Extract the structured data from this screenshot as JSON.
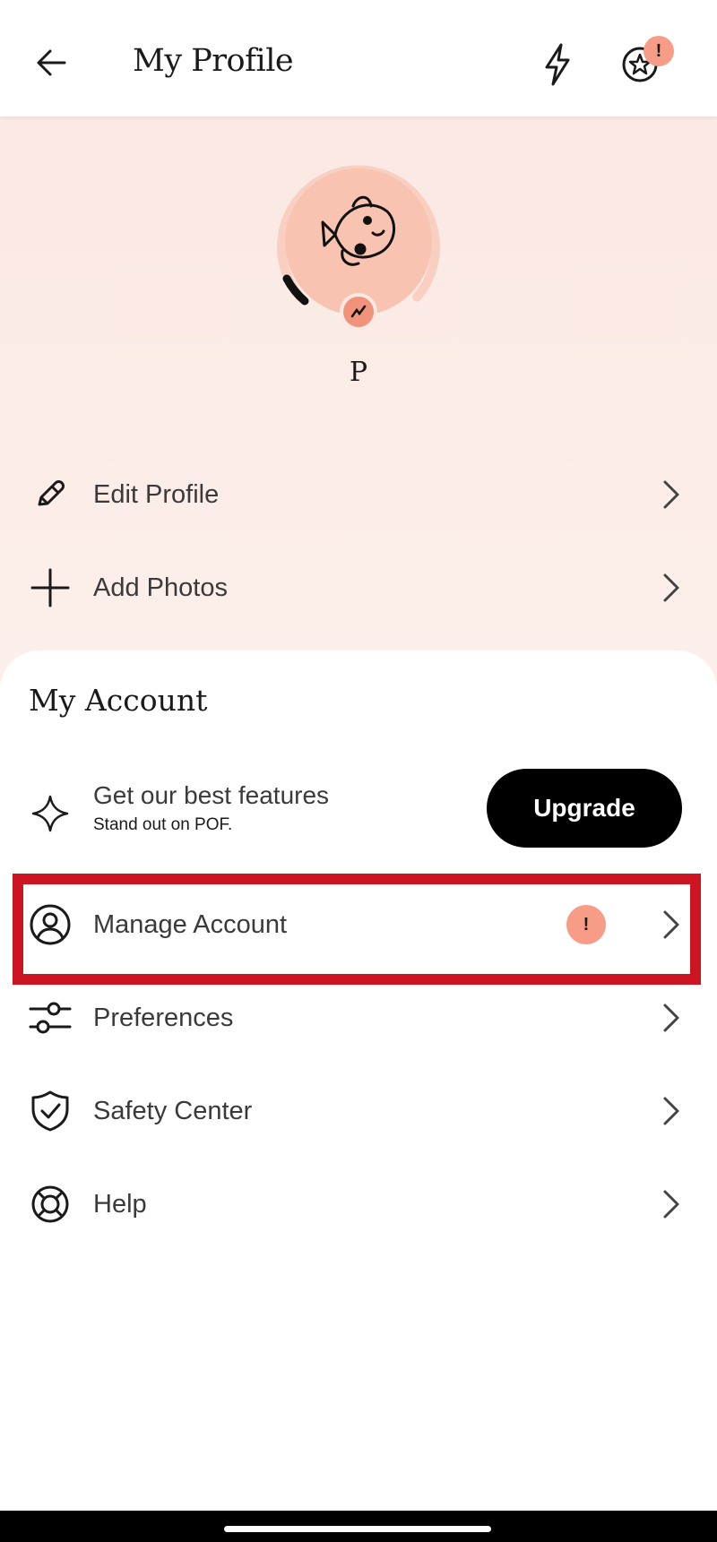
{
  "header": {
    "title": "My Profile",
    "star_alert": "!"
  },
  "profile": {
    "name": "P",
    "completion_fraction": 0.08,
    "accent_color": "#f7c3b0",
    "badge_color": "#f0937a"
  },
  "profile_actions": [
    {
      "label": "Edit Profile",
      "icon": "pencil-icon"
    },
    {
      "label": "Add Photos",
      "icon": "plus-icon"
    }
  ],
  "account": {
    "title": "My Account",
    "feature": {
      "title": "Get our best features",
      "subtitle": "Stand out on POF.",
      "button": "Upgrade"
    },
    "items": [
      {
        "label": "Manage Account",
        "icon": "user-circle-icon",
        "alert": "!"
      },
      {
        "label": "Preferences",
        "icon": "sliders-icon"
      },
      {
        "label": "Safety Center",
        "icon": "shield-check-icon"
      },
      {
        "label": "Help",
        "icon": "lifebuoy-icon"
      }
    ]
  },
  "colors": {
    "highlight": "#cc1423",
    "alert": "#f79c87",
    "profile_bg": "#fbe9e3"
  }
}
